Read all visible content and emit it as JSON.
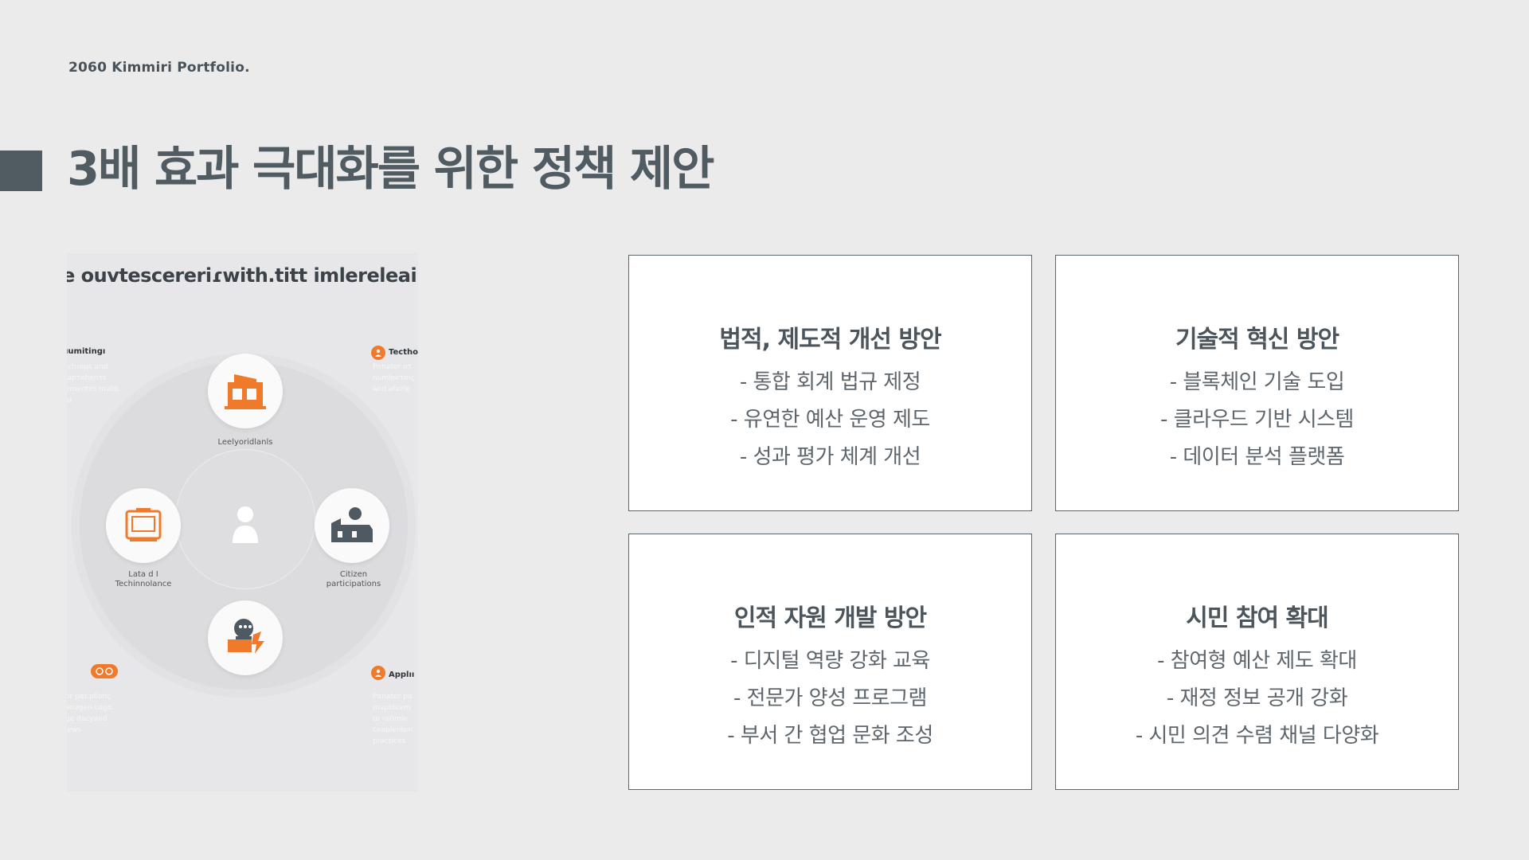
{
  "brand": "2060 Kimmiri Portfolio.",
  "title": "3배 효과 극대화를 위한 정책 제안",
  "infographic": {
    "heading": "e ouvtescereriɾwith.titt imlereleairt",
    "top_label": "Leelyoridlanls",
    "left_label_1": "Lata d I",
    "left_label_2": "Techinnolance",
    "right_label_1": "Citizen",
    "right_label_2": "participations",
    "side_top_left": "ıumitingı",
    "side_top_right": "Tecthoı",
    "side_bottom_right": "Applıı",
    "faint_left_top": [
      "ιctιιeμs and",
      "iapτehenτs",
      "ementes maldι",
      "ai"
    ],
    "faint_right_top": [
      "Pαnater oτ",
      "numleeτeις",
      "and afazle"
    ],
    "faint_left_bottom": [
      "or pαt.pllοnς",
      "anagen cαgα",
      "ge dacyand",
      "lews"
    ],
    "faint_right_bottom": [
      "Pαnater pα",
      "mapktcem",
      "to ratimie",
      "ceaplenten",
      "practices"
    ],
    "accent_color": "#f07a2b",
    "dark_color": "#4e5961"
  },
  "cards": [
    {
      "title": "법적, 제도적 개선 방안",
      "items": [
        "- 통합 회계 법규 제정",
        "- 유연한 예산 운영 제도",
        "- 성과 평가 체계 개선"
      ]
    },
    {
      "title": "기술적 혁신 방안",
      "items": [
        "- 블록체인 기술 도입",
        "- 클라우드 기반 시스템",
        "- 데이터 분석 플랫폼"
      ]
    },
    {
      "title": "인적 자원 개발 방안",
      "items": [
        "- 디지털 역량 강화 교육",
        "- 전문가 양성 프로그램",
        "- 부서 간 협업 문화 조성"
      ]
    },
    {
      "title": "시민 참여 확대",
      "items": [
        "- 참여형 예산 제도 확대",
        "- 재정 정보 공개 강화",
        "- 시민 의견 수렴 채널 다양화"
      ]
    }
  ]
}
